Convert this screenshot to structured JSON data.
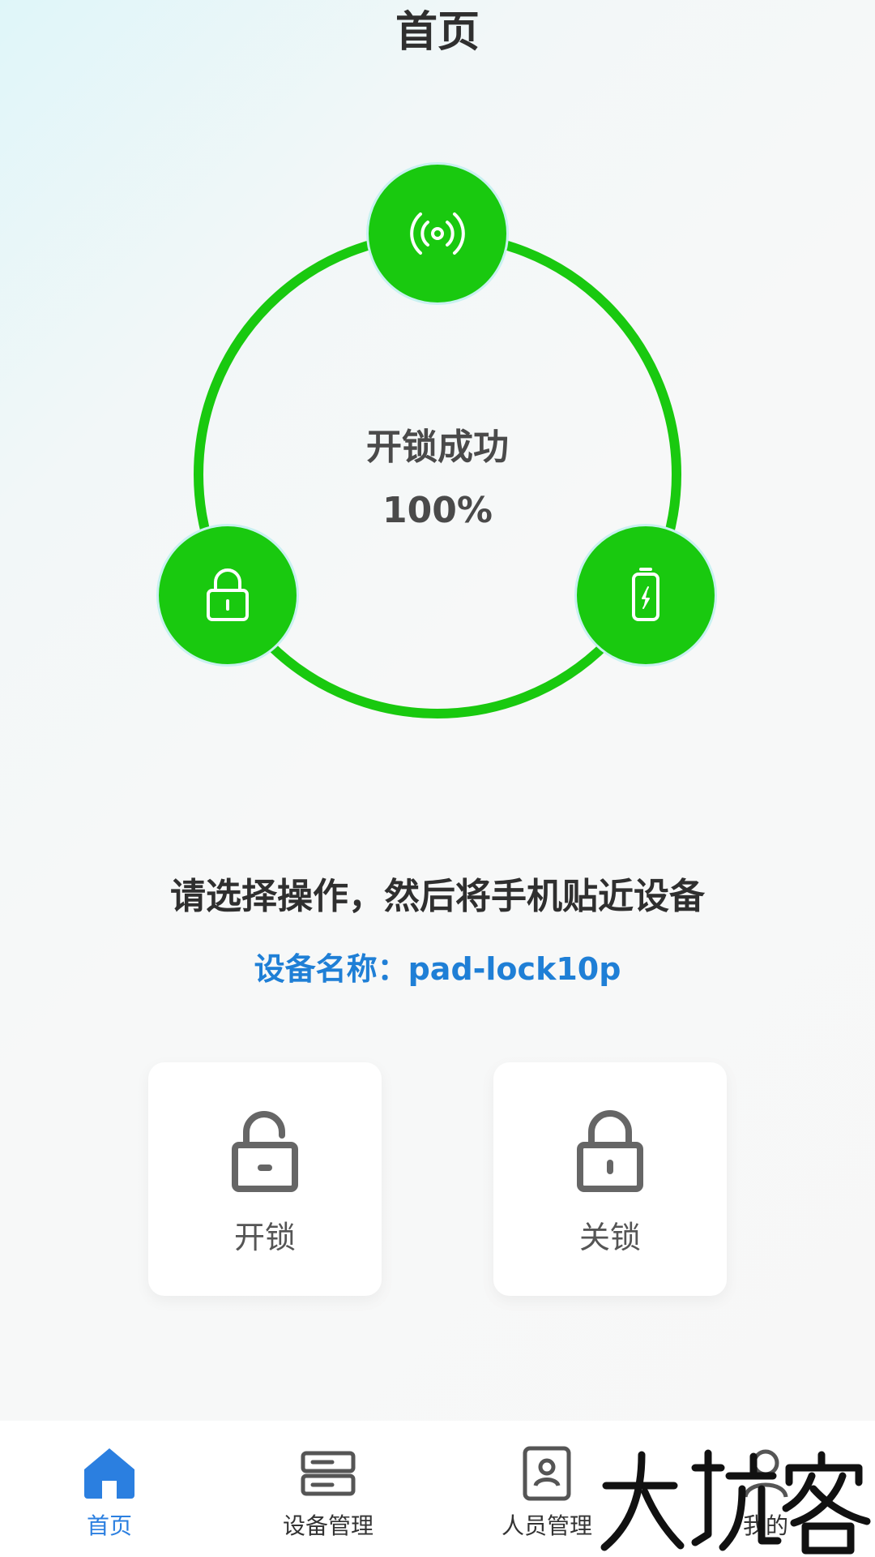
{
  "header": {
    "title": "首页"
  },
  "status": {
    "text": "开锁成功",
    "percent": "100%",
    "progress": 1.0,
    "accent_color": "#19c90f",
    "icons": [
      "signal-icon",
      "lock-icon",
      "battery-icon"
    ]
  },
  "main": {
    "instruction": "请选择操作，然后将手机贴近设备",
    "device_name_label": "设备名称：",
    "device_name_value": "pad-lock10p",
    "device_name_color": "#1f7fd6",
    "actions": [
      {
        "label": "开锁",
        "icon": "unlocked-padlock-icon"
      },
      {
        "label": "关锁",
        "icon": "locked-padlock-icon"
      }
    ]
  },
  "tab_bar": {
    "active_color": "#2b7fe0",
    "items": [
      {
        "label": "首页",
        "icon": "home-icon",
        "active": true
      },
      {
        "label": "设备管理",
        "icon": "device-icon",
        "active": false
      },
      {
        "label": "人员管理",
        "icon": "person-card-icon",
        "active": false
      },
      {
        "label": "我的",
        "icon": "user-icon",
        "active": false
      }
    ]
  },
  "watermark": {
    "text": "大玩客"
  }
}
